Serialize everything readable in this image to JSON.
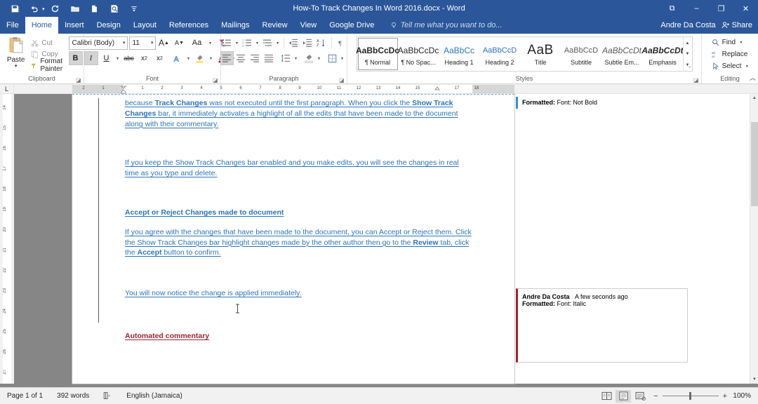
{
  "window": {
    "title": "How-To Track Changes In Word 2016.docx - Word",
    "minimize": "–",
    "maximize": "❐",
    "close": "✕",
    "ribbon_display_options": "⧉"
  },
  "quick_access": {
    "items": [
      {
        "name": "save-icon",
        "label": "Save"
      },
      {
        "name": "undo-icon",
        "label": "Undo"
      },
      {
        "name": "redo-icon",
        "label": "Redo"
      },
      {
        "name": "open-icon",
        "label": "Open"
      },
      {
        "name": "new-document-icon",
        "label": "New"
      },
      {
        "name": "print-preview-icon",
        "label": "Print Preview and Print"
      },
      {
        "name": "customize-quick-access-icon",
        "label": "Customize Quick Access Toolbar"
      }
    ]
  },
  "tabs": [
    {
      "label": "File",
      "active": false
    },
    {
      "label": "Home",
      "active": true
    },
    {
      "label": "Insert",
      "active": false
    },
    {
      "label": "Design",
      "active": false
    },
    {
      "label": "Layout",
      "active": false
    },
    {
      "label": "References",
      "active": false
    },
    {
      "label": "Mailings",
      "active": false
    },
    {
      "label": "Review",
      "active": false
    },
    {
      "label": "View",
      "active": false
    },
    {
      "label": "Google Drive",
      "active": false
    }
  ],
  "tell_me": "Tell me what you want to do...",
  "account": {
    "name": "Andre Da Costa",
    "share_label": "Share"
  },
  "ribbon": {
    "clipboard": {
      "group_label": "Clipboard",
      "paste_label": "Paste",
      "cut_label": "Cut",
      "copy_label": "Copy",
      "format_painter_label": "Format Painter"
    },
    "font": {
      "group_label": "Font",
      "font_name": "Calibri (Body)",
      "font_size": "11",
      "grow_font": "A",
      "shrink_font": "A",
      "change_case": "Aa",
      "clear_formatting": "Clear All Formatting",
      "bold": "B",
      "italic": "I",
      "underline": "U",
      "strikethrough": "abc",
      "subscript": "x",
      "superscript": "x",
      "text_effects": "A",
      "highlight": "Text Highlight Color",
      "font_color": "A"
    },
    "paragraph": {
      "group_label": "Paragraph",
      "buttons": [
        "bullets",
        "numbering",
        "multilevel-list",
        "decrease-indent",
        "increase-indent",
        "sort",
        "show-marks",
        "align-left",
        "align-center",
        "align-right",
        "justify",
        "line-spacing",
        "shading",
        "borders"
      ]
    },
    "styles": {
      "group_label": "Styles",
      "items": [
        {
          "preview": "AaBbCcDc",
          "name": "¶ Normal",
          "selected": true
        },
        {
          "preview": "AaBbCcDc",
          "name": "¶ No Spac...",
          "selected": false
        },
        {
          "preview": "AaBbCc",
          "name": "Heading 1",
          "selected": false
        },
        {
          "preview": "AaBbCcD",
          "name": "Heading 2",
          "selected": false
        },
        {
          "preview": "AaB",
          "name": "Title",
          "selected": false
        },
        {
          "preview": "AaBbCcD",
          "name": "Subtitle",
          "selected": false
        },
        {
          "preview": "AaBbCcDt",
          "name": "Subtle Em...",
          "selected": false
        },
        {
          "preview": "AaBbCcDt",
          "name": "Emphasis",
          "selected": false
        }
      ]
    },
    "editing": {
      "group_label": "Editing",
      "find_label": "Find",
      "replace_label": "Replace",
      "select_label": "Select"
    }
  },
  "ruler": {
    "tab_selector": "L",
    "horizontal_marks": [
      "2",
      "1",
      "1",
      "2",
      "3",
      "4",
      "5",
      "6",
      "7",
      "8",
      "9",
      "10",
      "11",
      "12",
      "13",
      "14",
      "15",
      "17",
      "18"
    ],
    "vertical_marks": [
      "14",
      "15",
      "16",
      "17",
      "18",
      "19",
      "20",
      "21",
      "22",
      "23",
      "24",
      "25",
      "26",
      "27"
    ]
  },
  "document": {
    "paragraphs": [
      {
        "id": "p1",
        "runs": [
          {
            "text": "because ",
            "bold": false
          },
          {
            "text": "Track Changes",
            "bold": true
          },
          {
            "text": " was not executed until the first paragraph. When you click the ",
            "bold": false
          },
          {
            "text": "Show Track Changes",
            "bold": true
          },
          {
            "text": " bar, it immediately activates a highlight of all the edits that have been made to the document along with their commentary.",
            "bold": false
          }
        ]
      },
      {
        "id": "p2",
        "runs": [
          {
            "text": "If you keep the Show Track Changes bar enabled and you make edits, you will see the changes in real time as you type and delete.",
            "bold": false
          }
        ]
      },
      {
        "id": "p3",
        "runs": [
          {
            "text": "Accept or Reject Changes made to document",
            "bold": true
          }
        ]
      },
      {
        "id": "p4",
        "runs": [
          {
            "text": "If you agree with the changes that have been made to the document, you can Accept or Reject them. Click the Show Track Changes bar highlight changes made by the other author then go to the ",
            "bold": false
          },
          {
            "text": "Review",
            "bold": true
          },
          {
            "text": " tab, click the ",
            "bold": false
          },
          {
            "text": "Accept",
            "bold": true
          },
          {
            "text": " button to confirm.",
            "bold": false
          }
        ]
      },
      {
        "id": "p5",
        "runs": [
          {
            "text": "You will now notice the change is applied immediately.",
            "bold": false
          }
        ]
      }
    ],
    "edited_heading": "Automated commentary",
    "track_change_color": "#2e74b5",
    "insertion_color": "#9d2235"
  },
  "markup": {
    "balloons": [
      {
        "id": "balloon-1",
        "author": "",
        "timestamp": "",
        "label": "Formatted:",
        "detail": " Font: Not Bold",
        "accent": "#3b8ec2"
      },
      {
        "id": "balloon-2",
        "author": "Andre Da Costa",
        "timestamp": "A few seconds ago",
        "label": "Formatted:",
        "detail": " Font: Italic",
        "accent": "#9d2235"
      }
    ]
  },
  "status_bar": {
    "page": "Page 1 of 1",
    "words": "392 words",
    "proofing_icon": "proofing-errors-icon",
    "language": "English (Jamaica)",
    "views": [
      {
        "name": "read-mode-view",
        "active": false
      },
      {
        "name": "print-layout-view",
        "active": true
      },
      {
        "name": "web-layout-view",
        "active": false
      }
    ],
    "zoom_out": "−",
    "zoom_in": "+",
    "zoom_level": "100%"
  }
}
